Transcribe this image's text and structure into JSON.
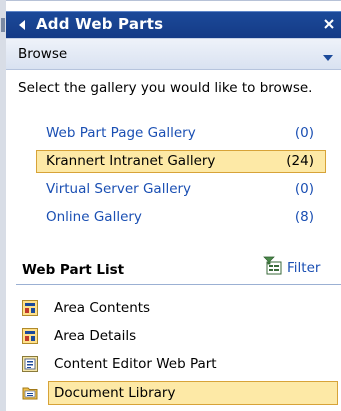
{
  "panel": {
    "title": "Add Web Parts",
    "close_glyph": "x"
  },
  "browse": {
    "label": "Browse"
  },
  "intro": {
    "text": "Select the gallery you would like to browse."
  },
  "galleries": [
    {
      "name": "Web Part Page Gallery",
      "count": "(0)"
    },
    {
      "name": "Krannert Intranet Gallery",
      "count": "(24)",
      "selected": true
    },
    {
      "name": "Virtual Server Gallery",
      "count": "(0)"
    },
    {
      "name": "Online Gallery",
      "count": "(8)"
    }
  ],
  "web_part_list": {
    "title": "Web Part List",
    "filter_label": "Filter",
    "items": [
      {
        "label": "Area Contents",
        "icon": "area-icon"
      },
      {
        "label": "Area Details",
        "icon": "area-icon"
      },
      {
        "label": "Content Editor Web Part",
        "icon": "content-editor-icon"
      },
      {
        "label": "Document Library",
        "icon": "folder-icon",
        "selected": true
      }
    ]
  },
  "colors": {
    "title_bar": "#143a85",
    "link": "#1a4fb3",
    "selection_fill": "#fde9a6",
    "selection_border": "#d7a338"
  }
}
